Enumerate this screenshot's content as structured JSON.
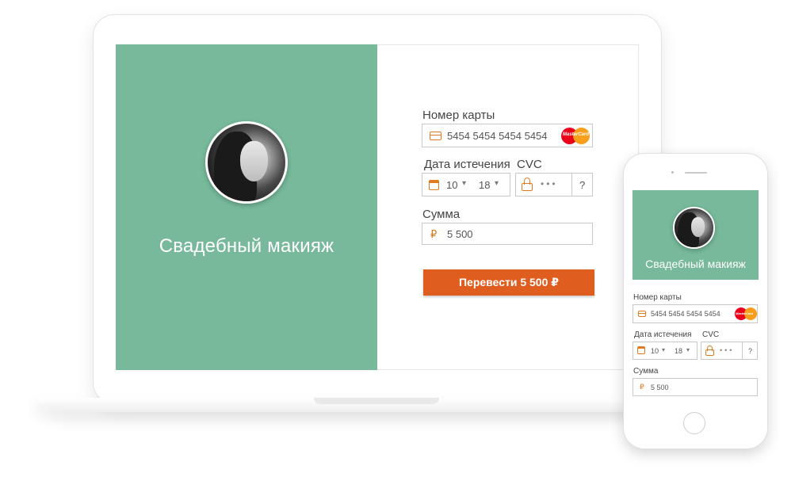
{
  "service": {
    "title": "Свадебный макияж"
  },
  "form": {
    "card_label": "Номер карты",
    "card_number": "5454 5454 5454 5454",
    "card_brand": "MasterCard",
    "expiry_label": "Дата истечения",
    "expiry_month": "10",
    "expiry_year": "18",
    "cvc_label": "CVC",
    "cvc_mask": "•••",
    "cvc_help": "?",
    "amount_label": "Сумма",
    "currency_symbol": "₽",
    "amount_value": "5 500",
    "submit_label": "Перевести 5 500 ₽"
  },
  "icons": {
    "card": "credit-card-icon",
    "calendar": "calendar-icon",
    "lock": "lock-icon",
    "dropdown": "▾"
  },
  "colors": {
    "accent_green": "#77b99a",
    "accent_orange": "#e05d20",
    "icon_orange": "#e07a1f"
  }
}
